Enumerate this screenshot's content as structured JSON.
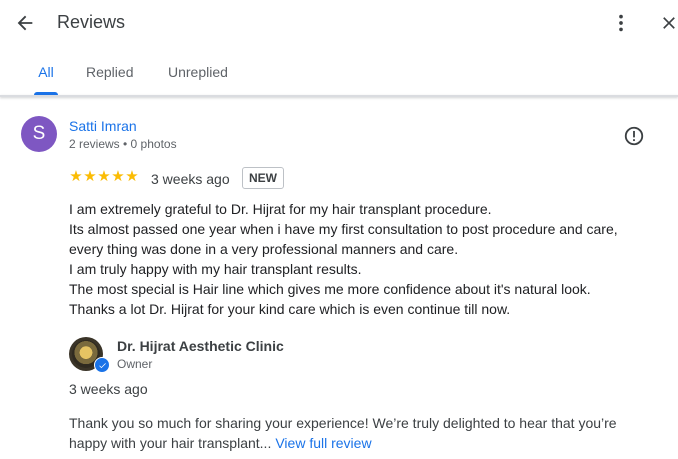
{
  "header": {
    "title": "Reviews",
    "back_icon": "arrow-left-icon",
    "more_icon": "more-vert-icon",
    "close_icon": "close-icon"
  },
  "tabs": [
    {
      "label": "All",
      "active": true
    },
    {
      "label": "Replied",
      "active": false
    },
    {
      "label": "Unreplied",
      "active": false
    }
  ],
  "review": {
    "avatar_letter": "S",
    "avatar_color": "#7e57c2",
    "reviewer_name": "Satti Imran",
    "reviewer_meta": "2 reviews • 0 photos",
    "rating": 5,
    "star_glyph": "★",
    "time": "3 weeks ago",
    "badge": "NEW",
    "text_lines": [
      "I am extremely grateful to Dr. Hijrat for my hair transplant procedure.",
      "Its almost passed one year when i have my first consultation to post procedure and care,",
      "every thing was done in a very professional manners and care.",
      "I am truly happy with my hair transplant results.",
      "The most special is Hair line which gives me more confidence about it's natural look.",
      "Thanks a lot Dr. Hijrat for your kind care which is even continue till now."
    ],
    "report_icon": "report-icon"
  },
  "reply": {
    "owner_name": "Dr. Hijrat Aesthetic Clinic",
    "owner_role": "Owner",
    "time": "3 weeks ago",
    "text_line1": "Thank you so much for sharing your experience! We’re truly delighted to hear that you’re",
    "text_line2": "happy with your hair transplant...",
    "view_full_label": "View full review"
  },
  "colors": {
    "accent": "#1a73e8",
    "star": "#fbbc04"
  }
}
